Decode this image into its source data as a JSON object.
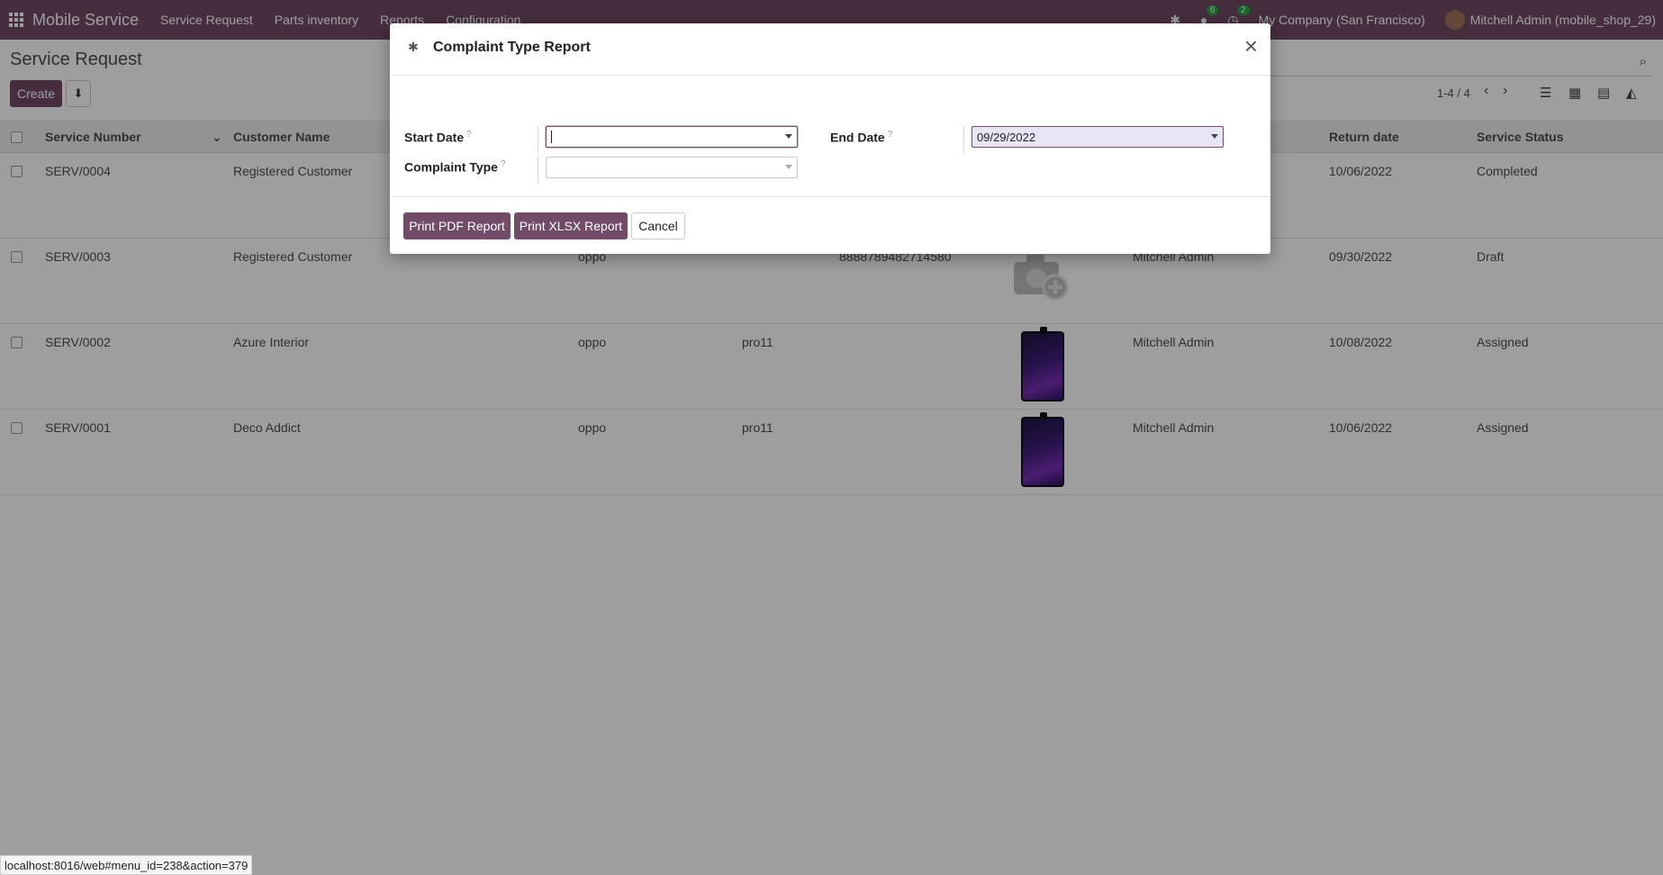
{
  "navbar": {
    "brand": "Mobile Service",
    "menu": [
      "Service Request",
      "Parts inventory",
      "Reports",
      "Configuration"
    ],
    "activity_badge": "6",
    "message_badge": "2",
    "company": "My Company (San Francisco)",
    "user": "Mitchell Admin (mobile_shop_29)",
    "icons": [
      "apps-grid-icon",
      "bug-icon",
      "chat-icon",
      "clock-icon"
    ],
    "color": "#714b67"
  },
  "control_panel": {
    "breadcrumb": "Service Request",
    "create_label": "Create",
    "download_icon": "download-icon",
    "pager": "1-4 / 4"
  },
  "list": {
    "columns": {
      "service_number": "Service Number",
      "customer_name": "Customer Name",
      "return_date": "Return date",
      "service_status": "Service Status"
    },
    "rows": [
      {
        "number": "SERV/0004",
        "customer": "Registered Customer",
        "brand": "",
        "model": "",
        "imei": "",
        "technician": "",
        "return_date": "10/06/2022",
        "status": "Completed",
        "image": "none"
      },
      {
        "number": "SERV/0003",
        "customer": "Registered Customer",
        "brand": "oppo",
        "model": "",
        "imei": "8888789482714580",
        "technician": "Mitchell Admin",
        "return_date": "09/30/2022",
        "status": "Draft",
        "image": "camera-placeholder"
      },
      {
        "number": "SERV/0002",
        "customer": "Azure Interior",
        "brand": "oppo",
        "model": "pro11",
        "imei": "",
        "technician": "Mitchell Admin",
        "return_date": "10/08/2022",
        "status": "Assigned",
        "image": "phone"
      },
      {
        "number": "SERV/0001",
        "customer": "Deco Addict",
        "brand": "oppo",
        "model": "pro11",
        "imei": "",
        "technician": "Mitchell Admin",
        "return_date": "10/06/2022",
        "status": "Assigned",
        "image": "phone"
      }
    ]
  },
  "dialog": {
    "title": "Complaint Type Report",
    "start_date_label": "Start Date",
    "end_date_label": "End Date",
    "complaint_type_label": "Complaint Type",
    "help_mark": "?",
    "start_date_value": "",
    "end_date_value": "09/29/2022",
    "complaint_type_value": "",
    "print_pdf": "Print PDF Report",
    "print_xlsx": "Print XLSX Report",
    "cancel": "Cancel"
  },
  "status_bar": {
    "url": "localhost:8016/web#menu_id=238&action=379"
  }
}
